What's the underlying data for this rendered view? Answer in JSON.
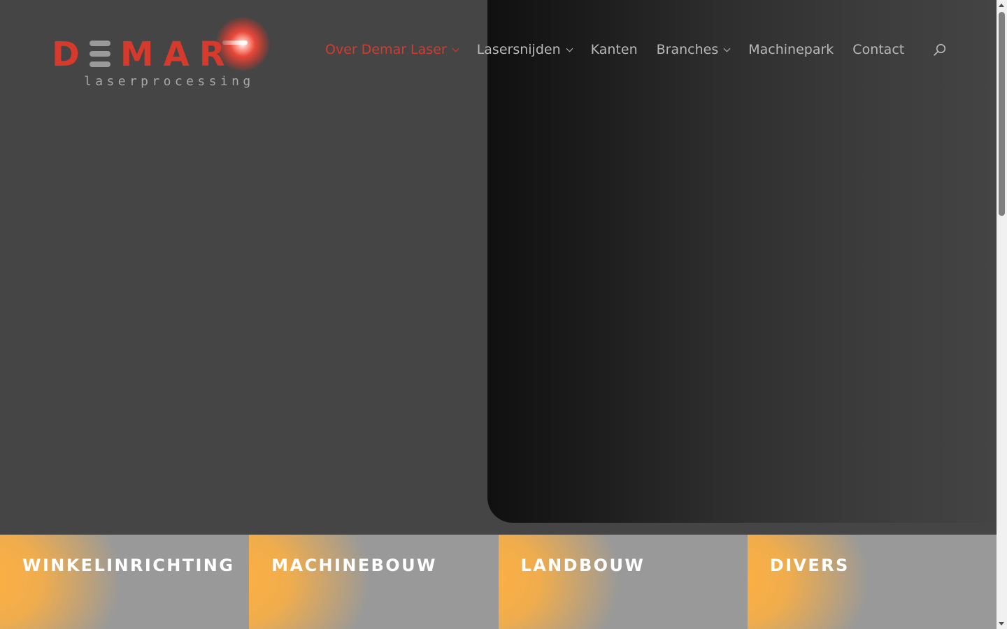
{
  "logo": {
    "word_start": "D",
    "word_end": "MAR",
    "tagline": "laserprocessing",
    "icon": "laser-flare-icon"
  },
  "nav": {
    "items": [
      {
        "label": "Over Demar Laser",
        "has_submenu": true,
        "active": true
      },
      {
        "label": "Lasersnijden",
        "has_submenu": true,
        "active": false
      },
      {
        "label": "Kanten",
        "has_submenu": false,
        "active": false
      },
      {
        "label": "Branches",
        "has_submenu": true,
        "active": false
      },
      {
        "label": "Machinepark",
        "has_submenu": false,
        "active": false
      },
      {
        "label": "Contact",
        "has_submenu": false,
        "active": false
      }
    ],
    "search_icon": "search-icon"
  },
  "tiles": [
    {
      "label": "WINKELINRICHTING"
    },
    {
      "label": "MACHINEBOUW"
    },
    {
      "label": "LANDBOUW"
    },
    {
      "label": "DIVERS"
    }
  ],
  "colors": {
    "brand_red": "#d63a2c",
    "nav_text": "#b8b8b8",
    "page_bg": "#454545",
    "tile_bg": "#999999",
    "tile_accent": "#ffb040"
  }
}
